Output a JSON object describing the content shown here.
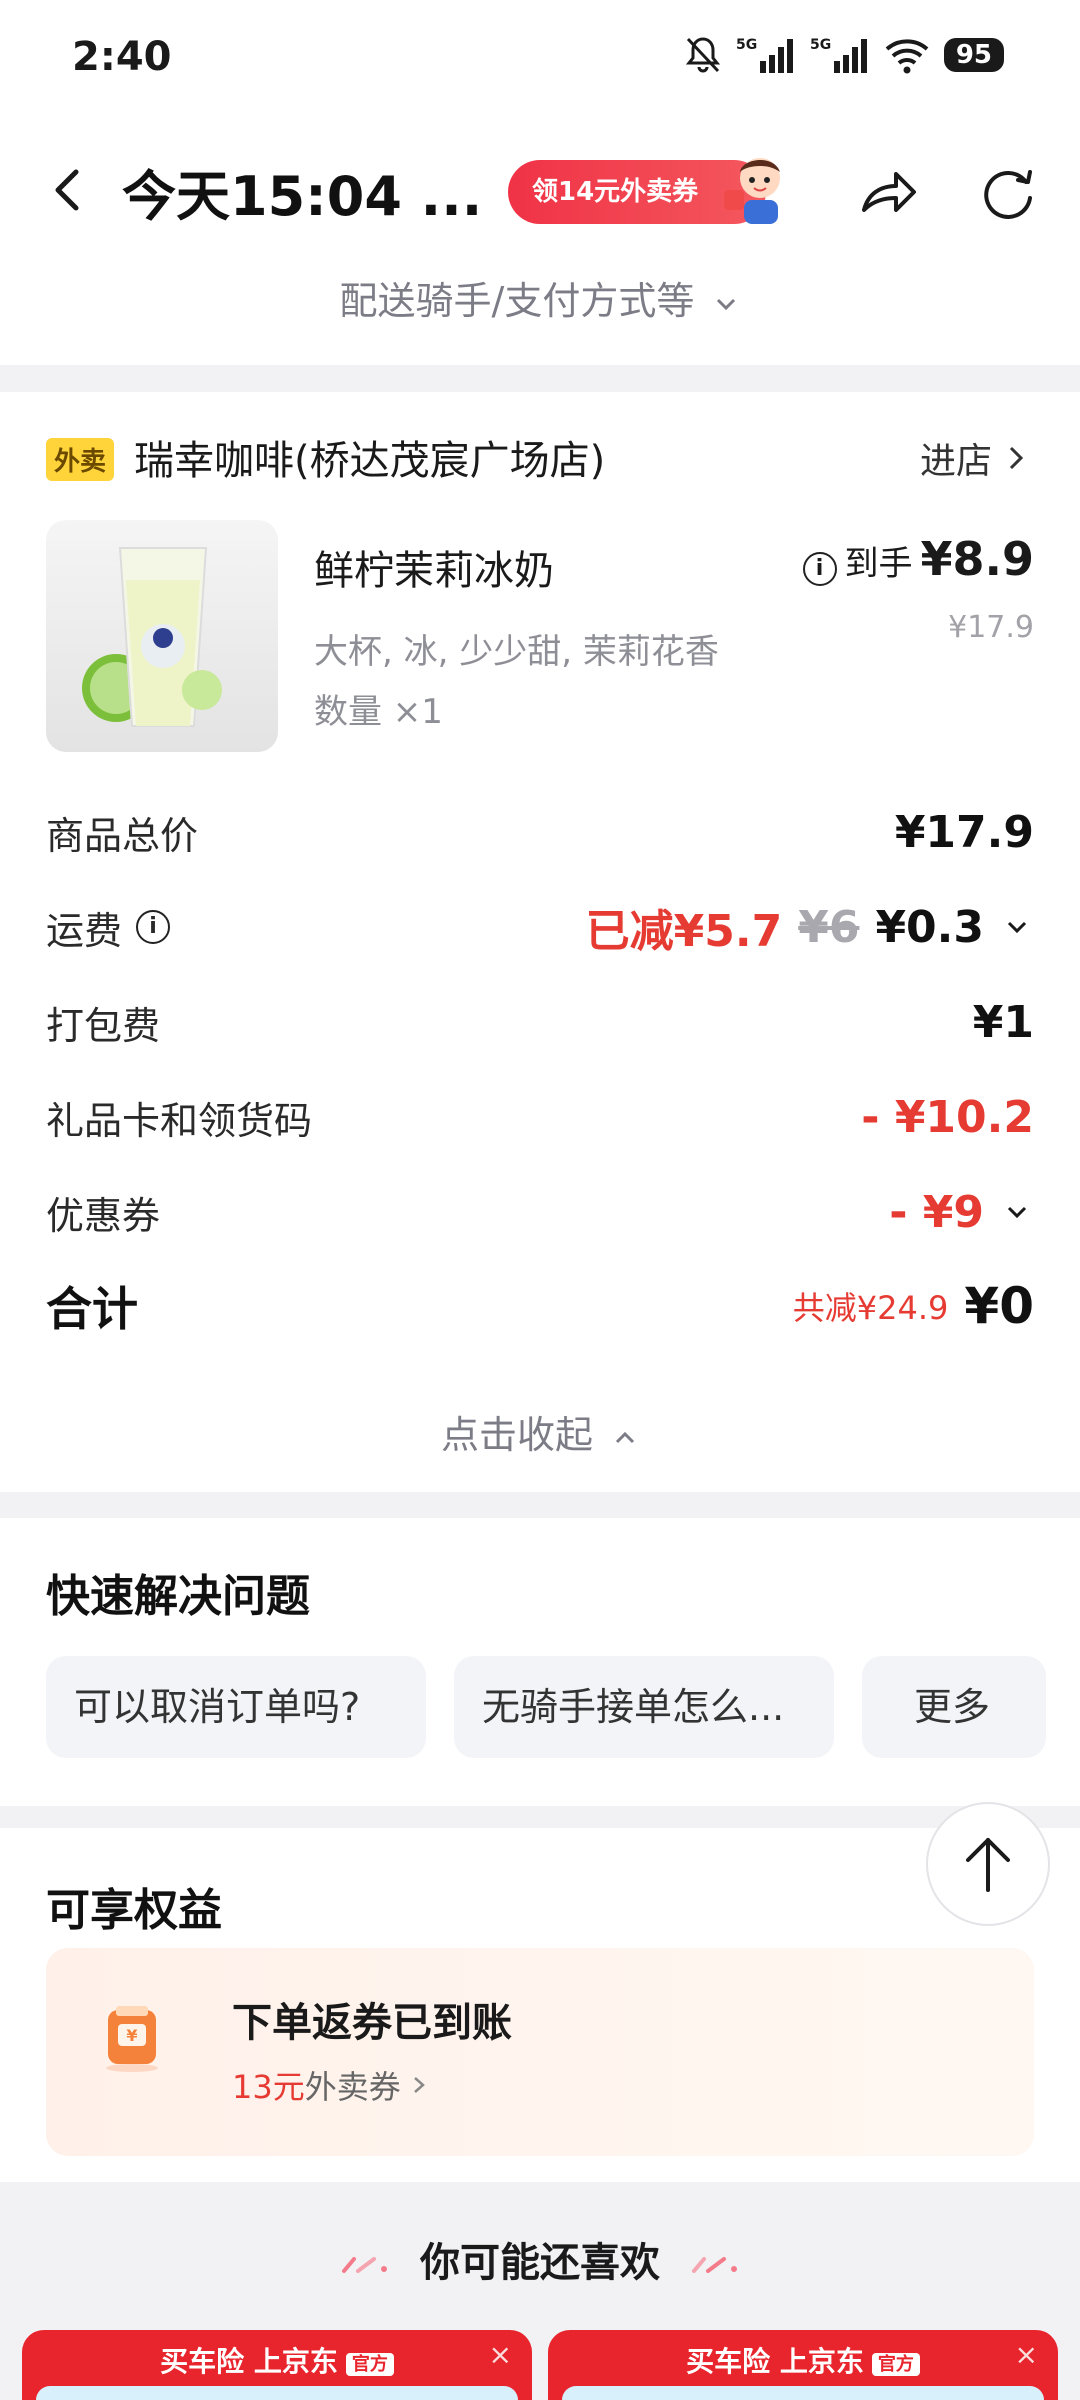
{
  "status_bar": {
    "time": "2:40",
    "battery": "95",
    "network": "5G"
  },
  "header": {
    "title": "今天15:04 ...",
    "coupon_label": "领14元外卖券",
    "delivery_link": "配送骑手/支付方式等"
  },
  "order": {
    "tag": "外卖",
    "store_name": "瑞幸咖啡(桥达茂宸广场店)",
    "enter_store": "进店",
    "product": {
      "name": "鲜柠茉莉冰奶",
      "spec": "大杯, 冰, 少少甜, 茉莉花香",
      "qty": "数量 ×1",
      "arrive_label": "到手",
      "arrive_price": "¥8.9",
      "original_price": "¥17.9"
    },
    "rows": {
      "subtotal": {
        "label": "商品总价",
        "value": "¥17.9"
      },
      "delivery": {
        "label": "运费",
        "reduced": "已减¥5.7",
        "original": "¥6",
        "value": "¥0.3"
      },
      "packing": {
        "label": "打包费",
        "value": "¥1"
      },
      "giftcard": {
        "label": "礼品卡和领货码",
        "value": "- ¥10.2"
      },
      "coupon": {
        "label": "优惠券",
        "value": "- ¥9"
      },
      "total": {
        "label": "合计",
        "saved": "共减¥24.9",
        "value": "¥0"
      }
    },
    "collapse_label": "点击收起"
  },
  "quick": {
    "title": "快速解决问题",
    "chips": [
      "可以取消订单吗?",
      "无骑手接单怎么...",
      "更多"
    ]
  },
  "benefits": {
    "title": "可享权益",
    "card_title": "下单返券已到账",
    "card_amount": "13元",
    "card_suffix": "外卖券"
  },
  "recommend": {
    "title": "你可能还喜欢",
    "ads": [
      {
        "text": "买车险 上京东",
        "badge": "官方"
      },
      {
        "text": "买车险 上京东",
        "badge": "官方"
      }
    ]
  }
}
